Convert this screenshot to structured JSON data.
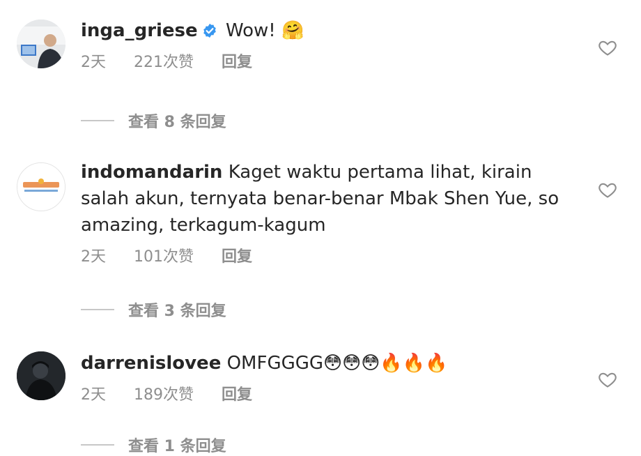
{
  "comments": [
    {
      "username": "inga_griese",
      "verified": true,
      "text": "Wow!",
      "emoji": "🤗",
      "time": "2天",
      "likes": "221次赞",
      "reply_label": "回复",
      "view_replies": "查看 8 条回复"
    },
    {
      "username": "indomandarin",
      "verified": false,
      "text": "Kaget waktu pertama lihat, kirain salah akun, ternyata benar-benar Mbak Shen Yue, so amazing, terkagum-kagum",
      "emoji": "",
      "time": "2天",
      "likes": "101次赞",
      "reply_label": "回复",
      "view_replies": "查看 3 条回复"
    },
    {
      "username": "darrenislovee",
      "verified": false,
      "text": "OMFGGGG",
      "emoji": "😳😳😳🔥🔥🔥",
      "time": "2天",
      "likes": "189次赞",
      "reply_label": "回复",
      "view_replies": "查看 1 条回复"
    }
  ],
  "colors": {
    "text": "#262626",
    "muted": "#8e8e8e",
    "verified_blue": "#3897f0"
  },
  "icons": {
    "verified": "verified-badge-icon",
    "like": "heart-outline-icon"
  }
}
